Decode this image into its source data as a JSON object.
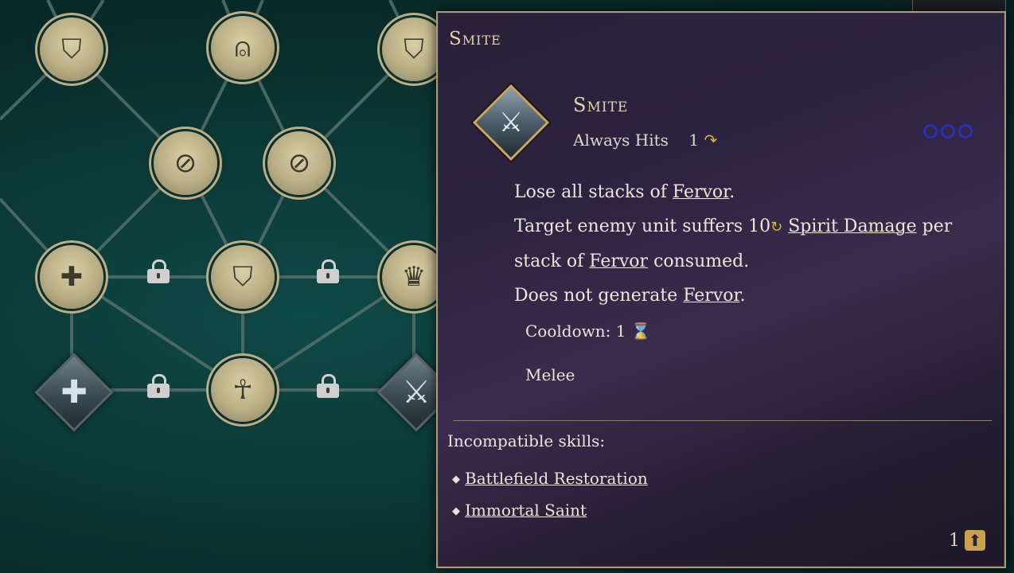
{
  "tooltip": {
    "title": "Smite",
    "skill": {
      "name": "Smite",
      "accuracy_label": "Always Hits",
      "ap_cost": "1",
      "accuracy_icon": "curved-arrow-icon",
      "icon": "sword-icon"
    },
    "description": {
      "line1_prefix": "Lose all stacks of ",
      "line1_link": "Fervor",
      "line1_suffix": ".",
      "line2_prefix": "Target enemy unit suffers 10",
      "line2_link": "Spirit Damage",
      "line2_mid": " per stack of ",
      "line2_link2": "Fervor",
      "line2_suffix": " consumed.",
      "line3_prefix": "Does not generate ",
      "line3_link": "Fervor",
      "line3_suffix": "."
    },
    "cooldown_label": "Cooldown: 1",
    "range": "Melee",
    "incompatible_label": "Incompatible skills:",
    "incompatible_skills": [
      "Battlefield Restoration",
      "Immortal Saint"
    ],
    "skill_point_cost": "1",
    "colors": {
      "accent": "#e4d3ad",
      "border": "#a99a7a",
      "dots": "#2a2fb0",
      "gold": "#e0b33c"
    }
  },
  "tree": {
    "locks": 4
  }
}
